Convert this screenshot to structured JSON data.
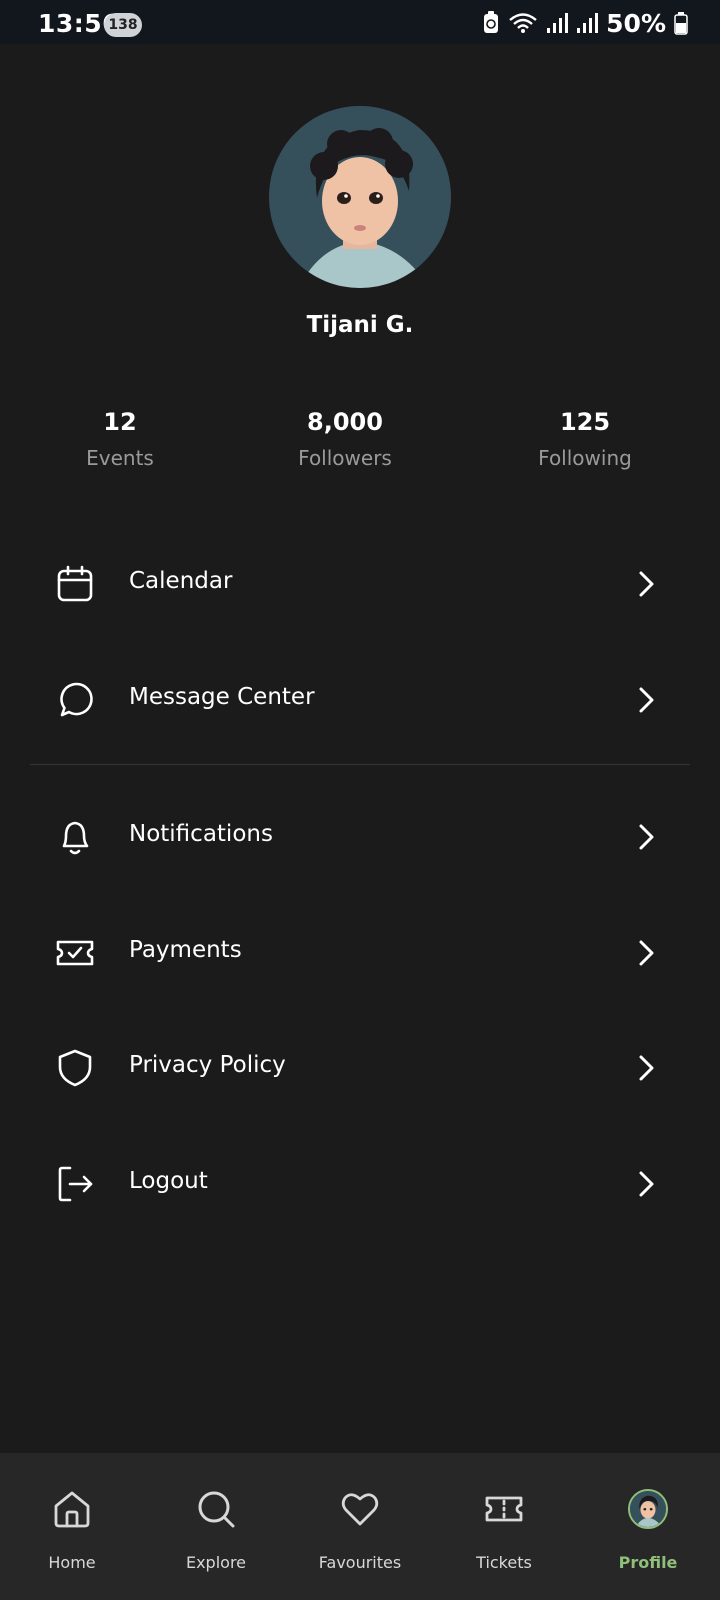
{
  "status_bar": {
    "time": "13:56",
    "notification_count": "138",
    "battery_percent": "50%"
  },
  "profile": {
    "name": "Tijani G.",
    "stats": [
      {
        "value": "12",
        "label": "Events"
      },
      {
        "value": "8,000",
        "label": "Followers"
      },
      {
        "value": "125",
        "label": "Following"
      }
    ]
  },
  "menu": {
    "items": [
      {
        "label": "Calendar",
        "icon": "calendar-icon"
      },
      {
        "label": "Message Center",
        "icon": "chat-bubble-icon"
      },
      {
        "label": "Notifications",
        "icon": "bell-icon"
      },
      {
        "label": "Payments",
        "icon": "ticket-check-icon"
      },
      {
        "label": "Privacy Policy",
        "icon": "shield-icon"
      },
      {
        "label": "Logout",
        "icon": "logout-icon"
      }
    ]
  },
  "bottom_nav": {
    "items": [
      {
        "label": "Home",
        "icon": "home-icon"
      },
      {
        "label": "Explore",
        "icon": "search-icon"
      },
      {
        "label": "Favourites",
        "icon": "heart-icon"
      },
      {
        "label": "Tickets",
        "icon": "ticket-icon"
      },
      {
        "label": "Profile",
        "icon": "avatar",
        "active": true
      }
    ]
  },
  "colors": {
    "background": "#1b1b1b",
    "nav_background": "#272727",
    "accent": "#8fbf7a",
    "secondary_text": "#9a9a9a"
  }
}
